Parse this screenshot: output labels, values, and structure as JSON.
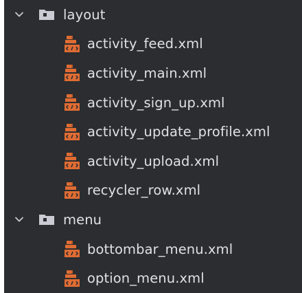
{
  "tree": {
    "layout_folder": {
      "label": "layout",
      "expanded": true,
      "files": [
        {
          "label": "activity_feed.xml"
        },
        {
          "label": "activity_main.xml"
        },
        {
          "label": "activity_sign_up.xml"
        },
        {
          "label": "activity_update_profile.xml"
        },
        {
          "label": "activity_upload.xml"
        },
        {
          "label": "recycler_row.xml"
        }
      ]
    },
    "menu_folder": {
      "label": "menu",
      "expanded": true,
      "files": [
        {
          "label": "bottombar_menu.xml"
        },
        {
          "label": "option_menu.xml"
        }
      ]
    }
  },
  "icons": {
    "folder": "folder-icon",
    "xml_file": "xml-file-icon",
    "chevron": "chevron-down-icon"
  },
  "colors": {
    "background": "#2b2d30",
    "text": "#dfe1e5",
    "folder_icon": "#c9ccd2",
    "xml_icon": "#e06c33"
  }
}
